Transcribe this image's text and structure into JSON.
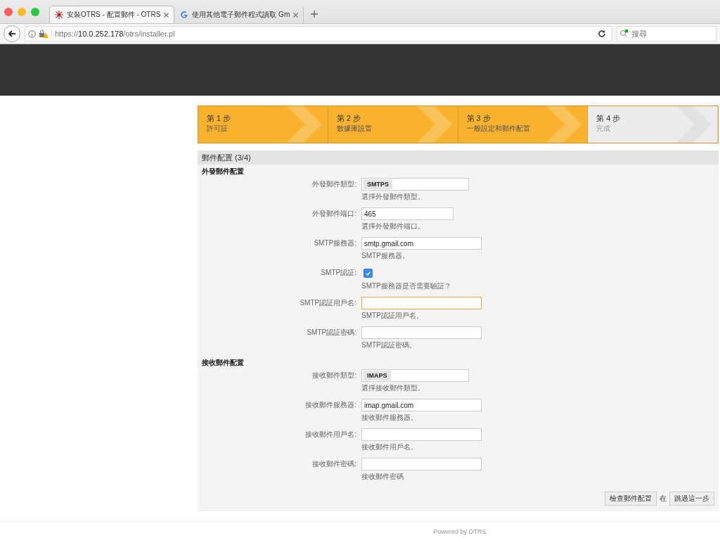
{
  "browser": {
    "tabs": [
      {
        "title": "安裝OTRS - 配置郵件 - OTRS",
        "kind": "otrs",
        "selected": true
      },
      {
        "title": "使用其他電子郵件程式讀取 Gm",
        "kind": "google",
        "selected": false
      }
    ],
    "url": "https://**10.0.252.178**/otrs/installer.pl",
    "search": {
      "placeholder": "搜尋"
    }
  },
  "steps": [
    {
      "title": "第 1 步",
      "subtitle": "許可証",
      "done": true
    },
    {
      "title": "第 2 步",
      "subtitle": "數據庫設置",
      "done": true
    },
    {
      "title": "第 3 步",
      "subtitle": "一般設定和郵件配置",
      "done": true
    },
    {
      "title": "第 4 步",
      "subtitle": "完成",
      "done": false
    }
  ],
  "panel": {
    "title": "郵件配置 (3/4)",
    "sections": [
      {
        "heading": "外發郵件配置",
        "fields": [
          {
            "kind": "select",
            "label": "外發郵件類型:",
            "value": "SMTPS",
            "hint": "選擇外發郵件類型。"
          },
          {
            "kind": "number",
            "label": "外發郵件端口:",
            "value": "465",
            "focused": false,
            "hint": "選擇外發郵件端口。"
          },
          {
            "kind": "text",
            "label": "SMTP服務器:",
            "value": "smtp.gmail.com",
            "focused": false,
            "hint": "SMTP服務器。"
          },
          {
            "kind": "checkbox",
            "label": "SMTP認証:",
            "checked": true,
            "hint": "SMTP服務器是否需要驗証？"
          },
          {
            "kind": "text",
            "label": "SMTP認証用戶名:",
            "focused": true,
            "hint": "SMTP認証用戶名。"
          },
          {
            "kind": "text",
            "label": "SMTP認証密碼:",
            "focused": false,
            "hint": "SMTP認証密碼。"
          }
        ]
      },
      {
        "heading": "接收郵件配置",
        "fields": [
          {
            "kind": "select",
            "label": "接收郵件類型:",
            "value": "IMAPS",
            "hint": "選擇接收郵件類型。"
          },
          {
            "kind": "text",
            "label": "接收郵件服務器:",
            "value": "imap.gmail.com",
            "focused": false,
            "hint": "接收郵件服務器。"
          },
          {
            "kind": "text",
            "label": "接收郵件用戶名:",
            "focused": false,
            "hint": "接收郵件用戶名。"
          },
          {
            "kind": "text",
            "label": "接收郵件密碼:",
            "focused": false,
            "hint": "接收郵件密碼"
          }
        ]
      }
    ],
    "actions": {
      "primary": "檢查郵件配置",
      "separator": "在",
      "secondary": "跳過這一步"
    }
  },
  "footer": "Powered by OTRS"
}
